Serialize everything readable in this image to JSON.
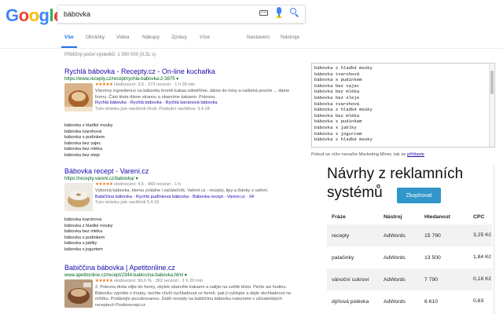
{
  "logo": {
    "letters": [
      "G",
      "o",
      "o",
      "g",
      "l",
      "e"
    ],
    "colors": [
      "#4285f4",
      "#ea4335",
      "#fbbc05",
      "#4285f4",
      "#34a853",
      "#ea4335"
    ]
  },
  "search": {
    "value": "bábovka"
  },
  "tabs": [
    {
      "label": "Vše",
      "active": true
    },
    {
      "label": "Obrázky"
    },
    {
      "label": "Videa"
    },
    {
      "label": "Nákupy"
    },
    {
      "label": "Zprávy"
    },
    {
      "label": "Více"
    },
    {
      "label": "Nastavení"
    },
    {
      "label": "Nástroje"
    }
  ],
  "stats": "Přibližný počet výsledků: 1 390 000 (0,31 s)",
  "results": [
    {
      "title": "Rychlá bábovka - Recepty.cz - On-line kuchařka",
      "url": "https://www.recepty.cz/recept/rychla-babovka-2-3875 ▾",
      "rating": "Hodnocení: 3,5 · 273 recenzí · 1 h 30 min",
      "snippet": "Všechny ingredience na bábovku kromě kakaa odměříme, dáme do mísy a našlehá prosím ... dáme formu. Část těsta dáme stranou a obarvíme kakaem. Polevnu.",
      "sitelinks": "Rychlá bábovka · Rychlá bábovka · Rychlá banánová bábovka",
      "meta": "Tuto stránku jste navštívili 2krát. Poslední návštěva: 3.4.18"
    },
    {
      "title": "Bábovka recept - Vareni.cz",
      "url": "https://recepty.vareni.cz/babovka/ ▾",
      "rating": "Hodnocení: 4,5 · 460 recenzí · 1 h",
      "snippet": "Výborná bábovka, kterou zvládne i začátečník. Vaření.cz - recepty, tipy a články o vaření.",
      "sitelinks": "Babiččina bábovka · Rychlá puďinková bábovka · Bábovka recept - Vareni.cz · 34",
      "meta": "Tuto stránku jste navštívili 5.4.18"
    },
    {
      "title": "Babiččina bábovka | Apetitonline.cz",
      "url": "www.apetitonline.cz/recept/2344-babiccina-babovka.html ▾",
      "rating": "Hodnocení: 90,6 % · 362 recenzí · 1 h 20 min",
      "snippet": "2. Polevnu těsta vlijte do formy, zbytek obarvěte kakaem a nalijte na světlé těsto. Pečte asi hodinu. Bábovku vyjměte z trouby, nechte chvíli vychladnout ve formě, pak ji vyklopte a dejte dochladnout na mřížku. Podávejte pocukrovanou. Další recepty na babiččinu bábovku naleznete v uživatelských receptech Poslinrecept.cz",
      "sitelinks": "",
      "meta": ""
    }
  ],
  "lists": [
    [
      "bábovka z hladké mouky",
      "bábovka tvarohová",
      "bábovka s pudinkem",
      "bábovka bez vajec",
      "bábovka bez mléka",
      "bábovka bez oleje"
    ],
    [
      "bábovka tvarohová",
      "bábovka z hladké mouky",
      "bábovka bez mléka",
      "bábovka s pudinkem",
      "bábovka s jablky",
      "bábovka s jogurtem"
    ]
  ],
  "keywords": [
    "bábovka z hladké mouky",
    "bábovka tvarohová",
    "bábovka s pudinkem",
    "bábovka bez vajec",
    "bábovka bez mléka",
    "bábovka bez oleje",
    "bábovka tvarohová",
    "bábovka z hladké mouky",
    "bábovka bez mléka",
    "bábovka s pudinkem",
    "bábovka s jablky",
    "bábovka s jogurtem",
    "bábovka z hladké mouky"
  ],
  "kw_note": {
    "text": "Pokud se níže nenačte Marketing Miner, tak se ",
    "link": "přihlaste"
  },
  "ads": {
    "title": "Návrhy z reklamních systémů",
    "copy_label": "Zkopírovat",
    "headers": [
      "Fráze",
      "Nástroj",
      "Hledanost",
      "CPC"
    ],
    "rows": [
      [
        "recepty",
        "AdWords",
        "15 790",
        "3,25 Kč"
      ],
      [
        "palačinky",
        "AdWords",
        "13 500",
        "1,84 Kč"
      ],
      [
        "vánoční cukroví",
        "AdWords",
        "7 790",
        "0,18 Kč"
      ],
      [
        "dýňová polévka",
        "AdWords",
        "6 610",
        "0,63"
      ]
    ]
  }
}
